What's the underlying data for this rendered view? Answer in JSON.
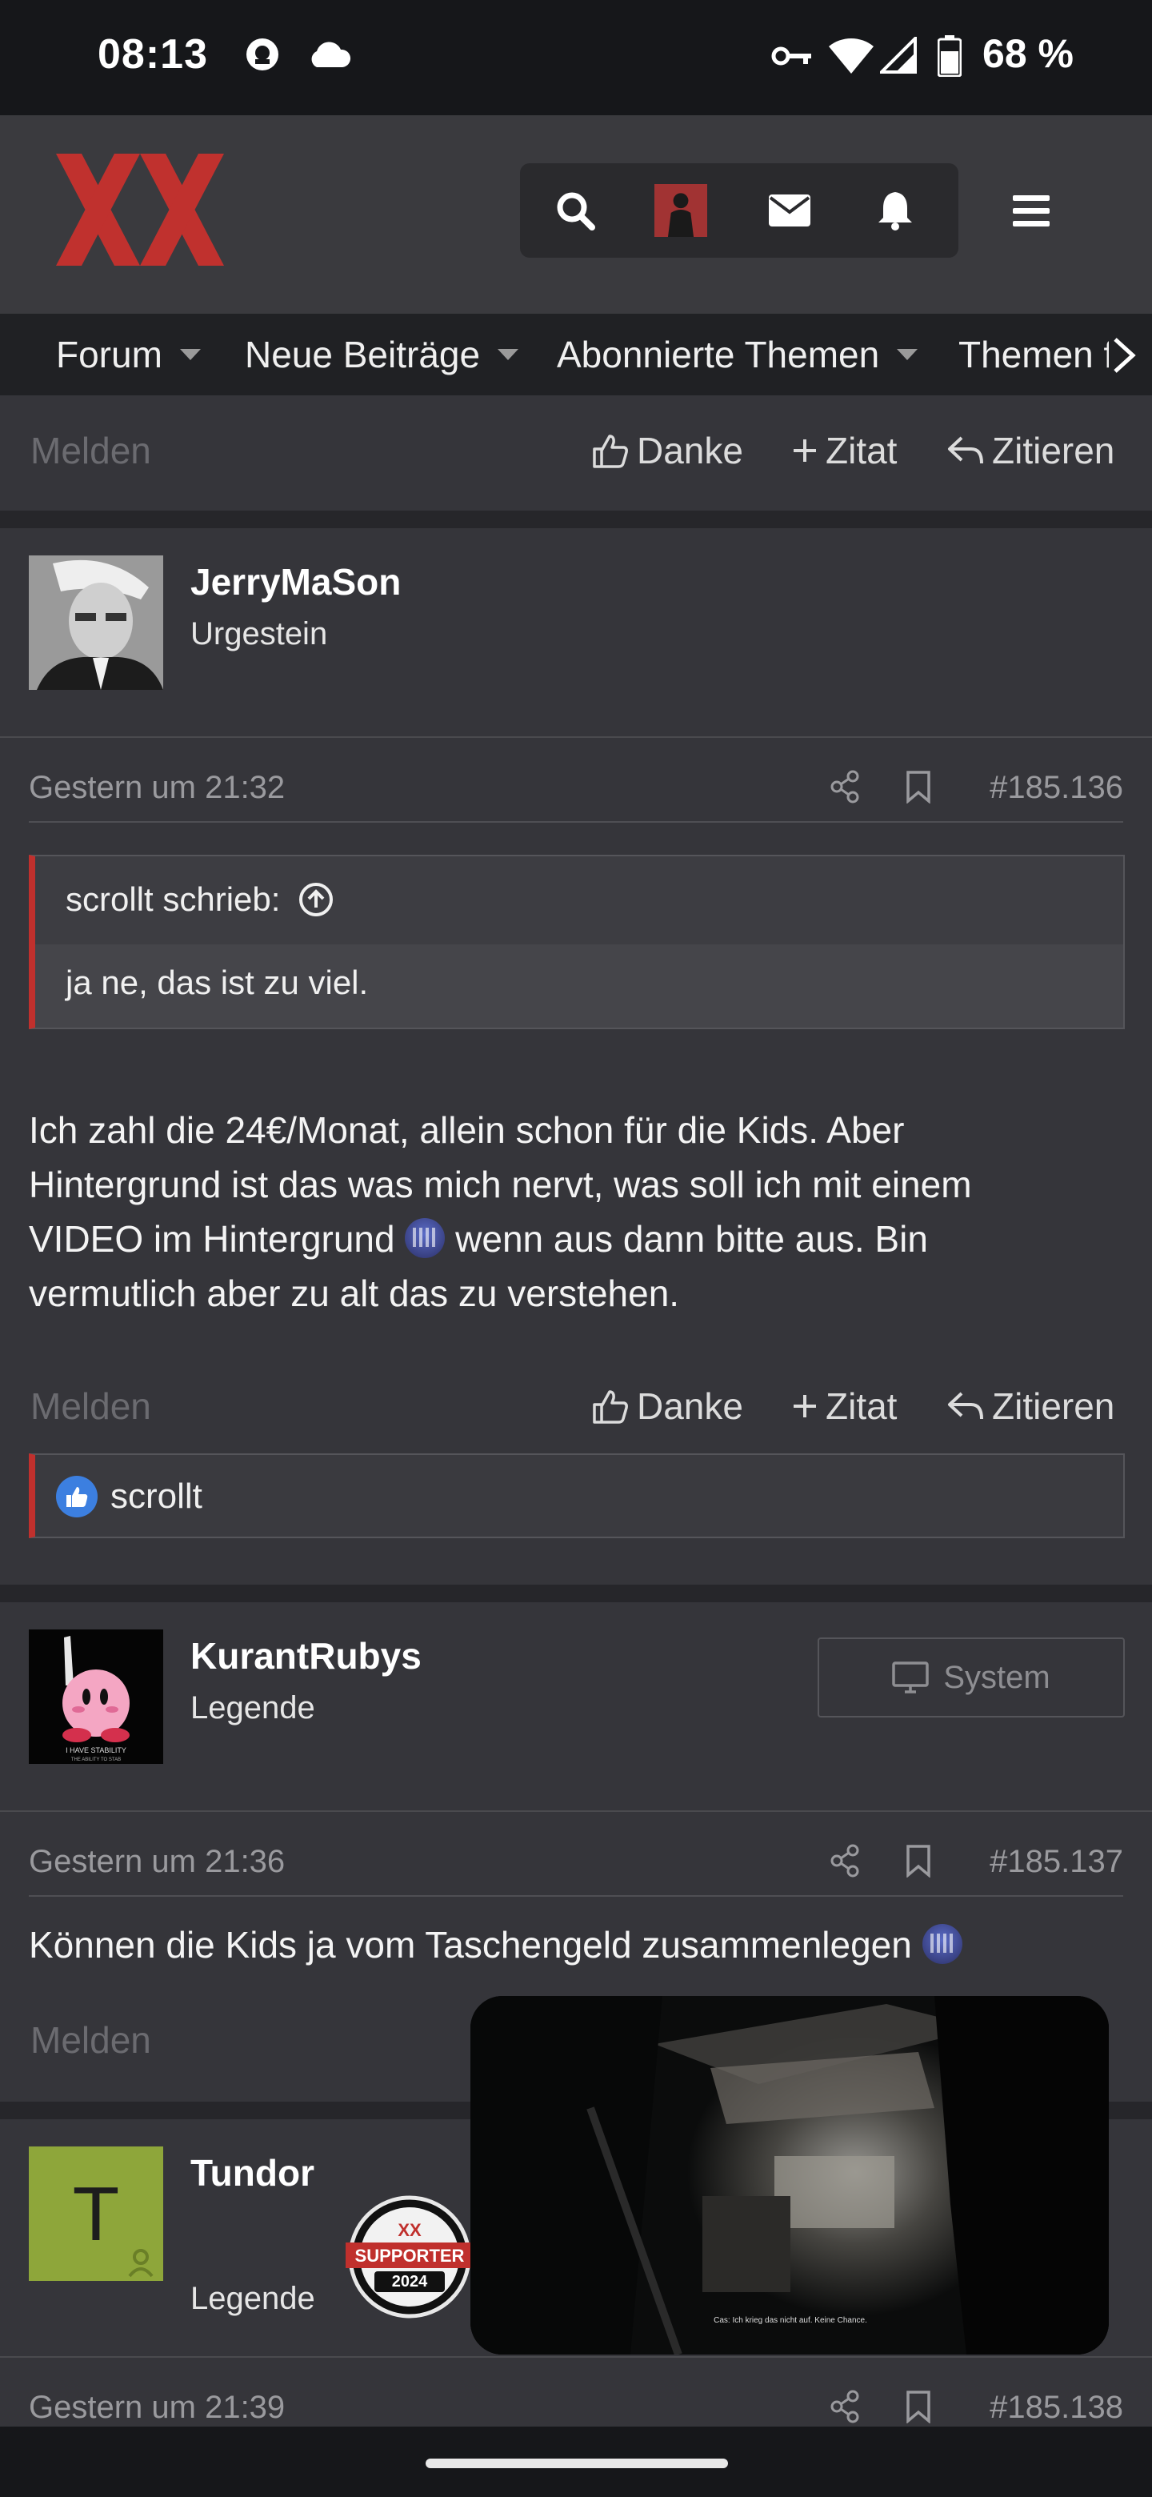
{
  "status_bar": {
    "time": "08:13",
    "battery": "68 %"
  },
  "nav": {
    "items": [
      {
        "label": "Forum",
        "has_caret": true
      },
      {
        "label": "Neue Beiträge",
        "has_caret": true
      },
      {
        "label": "Abonnierte Themen",
        "has_caret": true
      },
      {
        "label": "Themen fi",
        "has_caret": false
      }
    ]
  },
  "actions": {
    "report": "Melden",
    "thanks": "Danke",
    "multiquote": "Zitat",
    "quote": "Zitieren"
  },
  "posts": [
    {
      "author": "JerryMaSon",
      "role": "Urgestein",
      "date": "Gestern um 21:32",
      "number": "#185.136",
      "quote": {
        "author": "scrollt schrieb:",
        "text": "ja ne, das ist zu viel."
      },
      "text": [
        "Ich zahl die 24€/Monat, allein schon für die Kids. Aber",
        "Hintergrund ist das was mich nervt, was soll ich mit einem",
        "VIDEO im Hintergrund",
        "wenn aus dann bitte aus. Bin",
        "vermutlich aber zu alt das zu verstehen."
      ],
      "likes": "scrollt"
    },
    {
      "author": "KurantRubys",
      "role": "Legende",
      "system_label": "System",
      "date": "Gestern um 21:36",
      "number": "#185.137",
      "text": "Können die Kids ja vom Taschengeld zusammenlegen",
      "avatar_caption": "I HAVE STABILITY",
      "avatar_caption2": "THE ABILITY TO STAB"
    },
    {
      "author": "Tundor",
      "role": "Legende",
      "avatar_letter": "T",
      "badge_top": "XX",
      "badge_label": "SUPPORTER",
      "badge_year": "2024",
      "date": "Gestern um 21:39",
      "number": "#185.138"
    }
  ],
  "video": {
    "subtitle": "Cas: Ich krieg das nicht auf. Keine Chance."
  },
  "colors": {
    "brand_red": "#c0302d",
    "background": "#35353a",
    "header": "#3a3a3e",
    "like_blue": "#3c7fe0"
  }
}
